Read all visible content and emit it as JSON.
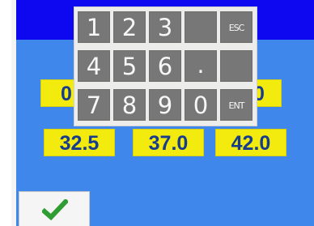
{
  "values": {
    "partial_left": "0",
    "partial_right": ".0",
    "row2": [
      "32.5",
      "37.0",
      "42.0"
    ]
  },
  "keypad": {
    "keys": {
      "one": "1",
      "two": "2",
      "three": "3",
      "blank_1": "",
      "esc": "ESC",
      "four": "4",
      "five": "5",
      "six": "6",
      "dot": ".",
      "blank_2": "",
      "seven": "7",
      "eight": "8",
      "nine": "9",
      "zero": "0",
      "ent": "ENT"
    }
  },
  "icons": {
    "confirm": "check-icon"
  },
  "colors": {
    "topbar": "#0d08f0",
    "background": "#3f87ea",
    "value_box": "#f3ea0e",
    "value_text": "#163c8d",
    "key": "#777777",
    "key_text": "#f7f7f7",
    "check": "#2f9d32"
  }
}
